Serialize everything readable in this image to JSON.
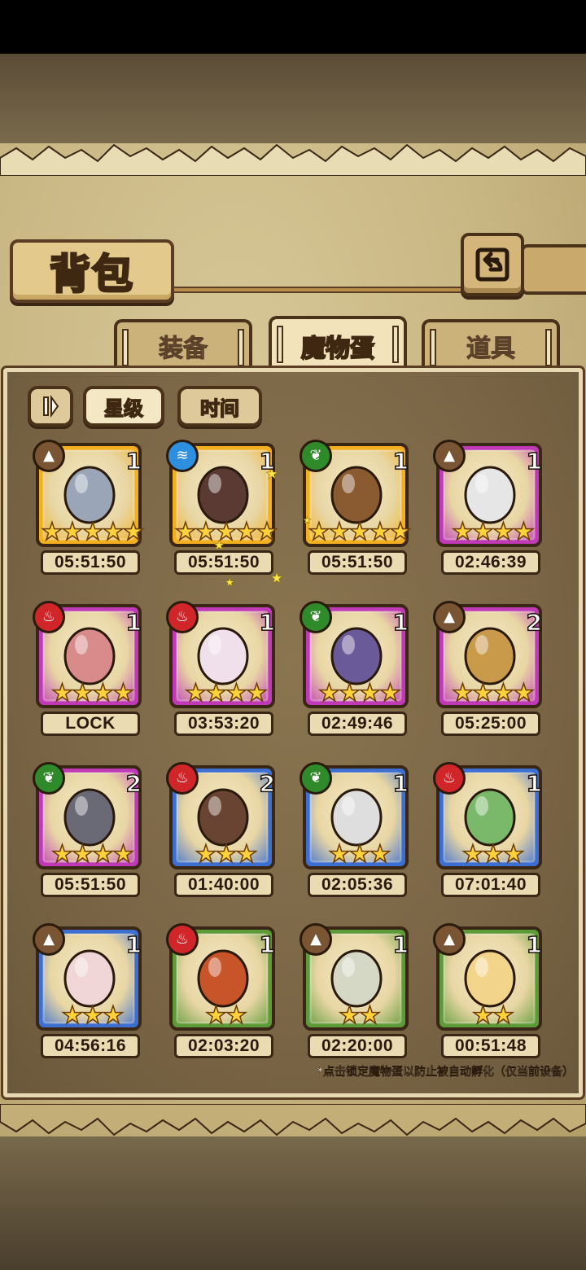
{
  "screen": {
    "title": "背包",
    "tabs": [
      {
        "label": "装备",
        "active": false
      },
      {
        "label": "魔物蛋",
        "active": true
      },
      {
        "label": "道具",
        "active": false
      }
    ],
    "sort_buttons": {
      "star": "星级",
      "time": "时间"
    },
    "footnote": "*点击锁定魔物蛋以防止被自动孵化（仅当前设备）"
  },
  "colors": {
    "frame_gold": "#f2b01e",
    "frame_purple": "#c03ab8",
    "frame_blue": "#3c6fd0",
    "frame_green": "#5d9a38",
    "element_earth": "#7a5534",
    "element_water": "#2d8fe0",
    "element_nature": "#2f8a2a",
    "element_fire": "#d0262a"
  },
  "eggs": [
    {
      "element": "earth",
      "element_icon": "mountain-icon",
      "count": "1",
      "stars": 5,
      "timer": "05:51:50",
      "frame": "gold",
      "art": "sword-egg"
    },
    {
      "element": "water",
      "element_icon": "wave-icon",
      "count": "1",
      "stars": 5,
      "timer": "05:51:50",
      "frame": "gold",
      "art": "staff-egg"
    },
    {
      "element": "nature",
      "element_icon": "leaf-icon",
      "count": "1",
      "stars": 5,
      "timer": "05:51:50",
      "frame": "gold",
      "art": "lyre-egg"
    },
    {
      "element": "earth",
      "element_icon": "mountain-icon",
      "count": "1",
      "stars": 4,
      "timer": "02:46:39",
      "frame": "purple",
      "art": "spider-egg"
    },
    {
      "element": "fire",
      "element_icon": "flame-icon",
      "count": "1",
      "stars": 4,
      "timer": "LOCK",
      "frame": "purple",
      "art": "crystal-orb-egg"
    },
    {
      "element": "fire",
      "element_icon": "flame-icon",
      "count": "1",
      "stars": 4,
      "timer": "03:53:20",
      "frame": "purple",
      "art": "winged-pink-egg"
    },
    {
      "element": "nature",
      "element_icon": "leaf-icon",
      "count": "1",
      "stars": 4,
      "timer": "02:49:46",
      "frame": "purple",
      "art": "butterfly-egg"
    },
    {
      "element": "earth",
      "element_icon": "mountain-icon",
      "count": "2",
      "stars": 4,
      "timer": "05:25:00",
      "frame": "purple",
      "art": "furry-gem-egg"
    },
    {
      "element": "nature",
      "element_icon": "leaf-icon",
      "count": "2",
      "stars": 4,
      "timer": "05:51:50",
      "frame": "purple",
      "art": "kunai-egg"
    },
    {
      "element": "fire",
      "element_icon": "flame-icon",
      "count": "2",
      "stars": 3,
      "timer": "01:40:00",
      "frame": "blue",
      "art": "horned-fur-egg"
    },
    {
      "element": "nature",
      "element_icon": "leaf-icon",
      "count": "1",
      "stars": 3,
      "timer": "02:05:36",
      "frame": "blue",
      "art": "spiked-collar-egg"
    },
    {
      "element": "fire",
      "element_icon": "flame-icon",
      "count": "1",
      "stars": 3,
      "timer": "07:01:40",
      "frame": "blue",
      "art": "cactus-egg"
    },
    {
      "element": "earth",
      "element_icon": "mountain-icon",
      "count": "1",
      "stars": 3,
      "timer": "04:56:16",
      "frame": "blue",
      "art": "bow-egg"
    },
    {
      "element": "fire",
      "element_icon": "flame-icon",
      "count": "1",
      "stars": 2,
      "timer": "02:03:20",
      "frame": "green",
      "art": "lava-egg"
    },
    {
      "element": "earth",
      "element_icon": "mountain-icon",
      "count": "1",
      "stars": 2,
      "timer": "02:20:00",
      "frame": "green",
      "art": "scarf-egg"
    },
    {
      "element": "earth",
      "element_icon": "mountain-icon",
      "count": "1",
      "stars": 2,
      "timer": "00:51:48",
      "frame": "green",
      "art": "wrapped-egg"
    }
  ]
}
